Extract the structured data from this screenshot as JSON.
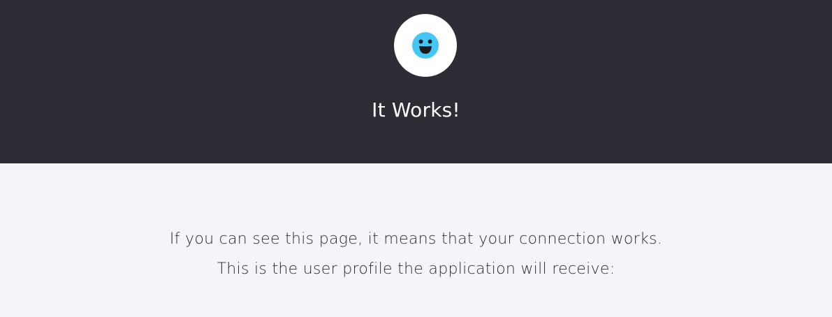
{
  "colors": {
    "header_bg": "#2d2d35",
    "content_bg": "#f4f5f9",
    "accent": "#44c7f4",
    "text": "#2b2b33"
  },
  "header": {
    "logo_icon": "smiley-icon",
    "title": "It Works!"
  },
  "main": {
    "line1": "If you can see this page, it means that your connection works.",
    "line2": "This is the user profile the application will receive:"
  }
}
